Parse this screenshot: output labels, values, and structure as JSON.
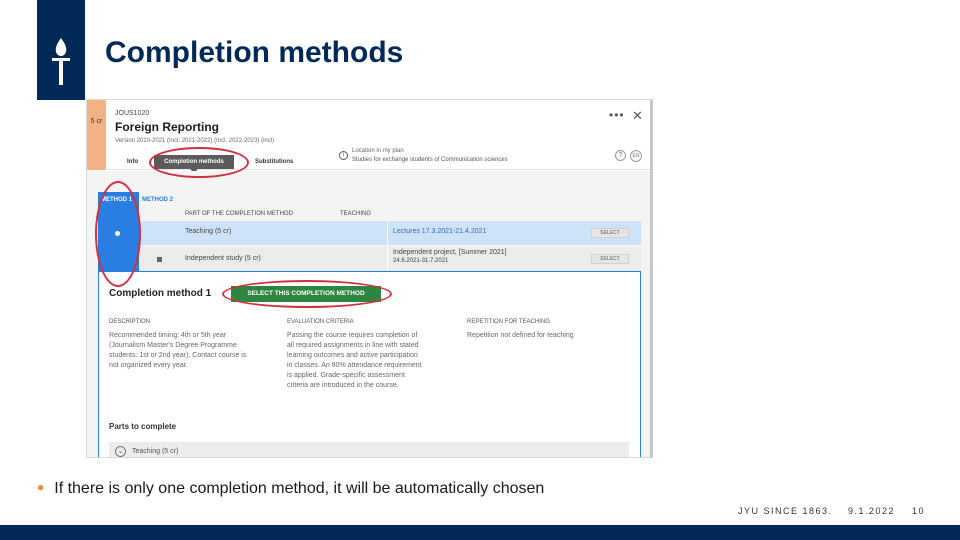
{
  "slide": {
    "title": "Completion methods",
    "bullet": "If there is only one completion method, it will be automatically chosen",
    "footer_org": "JYU SINCE 1863.",
    "footer_date": "9.1.2022",
    "footer_page": "10"
  },
  "course": {
    "credits": "5 cr",
    "code": "JOUS1020",
    "title": "Foreign Reporting",
    "version": "Version 2020-2021 (Incl. 2021-2022) (Incl. 2022-2023) (incl)",
    "tabs": [
      "Info",
      "Completion methods",
      "Substitutions"
    ],
    "location_label": "Location in my plan",
    "location_value": "Studies for exchange students of Communication sciences",
    "more_symbol": "•••",
    "close_symbol": "✕",
    "help_symbol": "?",
    "lang_symbol": "EN"
  },
  "methods": {
    "tabs": [
      "METHOD 1",
      "METHOD 2"
    ],
    "header_part": "PART OF THE COMPLETION METHOD",
    "header_teaching": "TEACHING",
    "rows": [
      {
        "part": "Teaching (5 cr)",
        "teaching": "Lectures 17.3.2021-21.4.2021",
        "teaching2": "",
        "button": "SELECT"
      },
      {
        "part": "Independent study (5 cr)",
        "teaching": "Independent project, [Summer 2021]",
        "teaching2": "24.6.2021-31.7.2021",
        "button": "SELECT"
      }
    ]
  },
  "detail": {
    "title": "Completion method 1",
    "select_button": "SELECT THIS COMPLETION METHOD",
    "description_h": "DESCRIPTION",
    "description_lines": [
      "Recommended timing: 4th or 5th year",
      "(Journalism Master's Degree Programme",
      "students: 1st or 2nd year). Contact course is",
      "not organized every year."
    ],
    "evaluation_h": "EVALUATION CRITERIA",
    "evaluation_lines": [
      "Passing the course requires completion of",
      "all required assignments in line with stated",
      "learning outcomes and active participation",
      "in classes. An 80% attendance requirement",
      "is applied. Grade-specific assessment",
      "criteria are introduced in the course."
    ],
    "repetition_h": "REPETITION FOR TEACHING",
    "repetition_text": "Repetition not defined for teaching",
    "parts_title": "Parts to complete",
    "part_item": "Teaching (5 cr)",
    "chevron_symbol": "⌄"
  },
  "colors": {
    "brand_navy": "#002957",
    "accent_orange": "#f0813e",
    "method_blue": "#2a7de1",
    "select_green": "#2e8540",
    "annotation_red": "#d1303d"
  }
}
